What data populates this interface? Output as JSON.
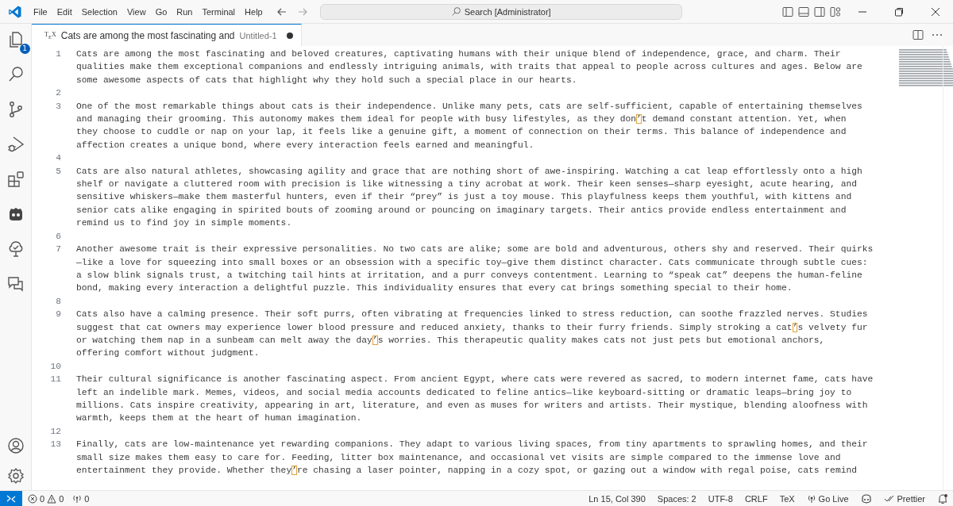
{
  "title_bar": {
    "menu": [
      "File",
      "Edit",
      "Selection",
      "View",
      "Go",
      "Run",
      "Terminal",
      "Help"
    ],
    "search": {
      "placeholder": "Search [Administrator]"
    }
  },
  "activity_bar": {
    "explorer_badge": "1"
  },
  "tabs": [
    {
      "type_badge": "T$_{E}$X",
      "label": "Cats are among the most fascinating and",
      "description": "Untitled-1",
      "selected": true,
      "dirty": true
    }
  ],
  "editor": {
    "lines": [
      {
        "number": "1",
        "text": "Cats are among the most fascinating and beloved creatures, captivating humans with their unique blend of independence, grace, and charm. Their qualities make them exceptional companions and endlessly intriguing animals, with traits that appeal to people across cultures and ages. Below are some awesome aspects of cats that highlight why they hold such a special place in our hearts."
      },
      {
        "number": "2"
      },
      {
        "number": "3",
        "text": "One of the most remarkable things about cats is their independence. Unlike many pets, cats are self-sufficient, capable of entertaining themselves and managing their grooming. This autonomy makes them ideal for people with busy lifestyles, as they don’t demand constant attention. Yet, when they choose to cuddle or nap on your lap, it feels like a genuine gift, a moment of connection on their terms. This balance of independence and affection creates a unique bond, where every interaction feels earned and meaningful."
      },
      {
        "number": "4"
      },
      {
        "number": "5",
        "text": "Cats are also natural athletes, showcasing agility and grace that are nothing short of awe-inspiring. Watching a cat leap effortlessly onto a high shelf or navigate a cluttered room with precision is like witnessing a tiny acrobat at work. Their keen senses—sharp eyesight, acute hearing, and sensitive whiskers—make them masterful hunters, even if their “prey” is just a toy mouse. This playfulness keeps them youthful, with kittens and senior cats alike engaging in spirited bouts of zooming around or pouncing on imaginary targets. Their antics provide endless entertainment and remind us to find joy in simple moments."
      },
      {
        "number": "6"
      },
      {
        "number": "7",
        "text": "Another awesome trait is their expressive personalities. No two cats are alike; some are bold and adventurous, others shy and reserved. Their quirks—like a love for squeezing into small boxes or an obsession with a specific toy—give them distinct character. Cats communicate through subtle cues: a slow blink signals trust, a twitching tail hints at irritation, and a purr conveys contentment. Learning to “speak cat” deepens the human-feline bond, making every interaction a delightful puzzle. This individuality ensures that every cat brings something special to their home."
      },
      {
        "number": "8"
      },
      {
        "number": "9",
        "text": "Cats also have a calming presence. Their soft purrs, often vibrating at frequencies linked to stress reduction, can soothe frazzled nerves. Studies suggest that cat owners may experience lower blood pressure and reduced anxiety, thanks to their furry friends. Simply stroking a cat’s velvety fur or watching them nap in a sunbeam can melt away the day’s worries. This therapeutic quality makes cats not just pets but emotional anchors, offering comfort without judgment."
      },
      {
        "number": "10"
      },
      {
        "number": "11",
        "text": "Their cultural significance is another fascinating aspect. From ancient Egypt, where cats were revered as sacred, to modern internet fame, cats have left an indelible mark. Memes, videos, and social media accounts dedicated to feline antics—like keyboard-sitting or dramatic leaps—bring joy to millions. Cats inspire creativity, appearing in art, literature, and even as muses for writers and artists. Their mystique, blending aloofness with warmth, keeps them at the heart of human imagination."
      },
      {
        "number": "12"
      },
      {
        "number": "13",
        "text": "Finally, cats are low-maintenance yet rewarding companions. They adapt to various living spaces, from tiny apartments to sprawling homes, and their small size makes them easy to care for. Feeding, litter box maintenance, and occasional vet visits are simple compared to the immense love and entertainment they provide. Whether they’re chasing a laser pointer, napping in a cozy spot, or gazing out a window with regal poise, cats remind"
      }
    ]
  },
  "status_bar": {
    "errors": "0",
    "warnings": "0",
    "ports": "0",
    "right": [
      {
        "kind": "text",
        "label": "Ln 15, Col 390"
      },
      {
        "kind": "text",
        "label": "Spaces: 2"
      },
      {
        "kind": "text",
        "label": "UTF-8"
      },
      {
        "kind": "text",
        "label": "CRLF"
      },
      {
        "kind": "text",
        "label": "TeX"
      },
      {
        "kind": "golive",
        "label": "Go Live"
      },
      {
        "kind": "copilot"
      },
      {
        "kind": "prettier",
        "label": "Prettier"
      },
      {
        "kind": "bell"
      }
    ]
  }
}
